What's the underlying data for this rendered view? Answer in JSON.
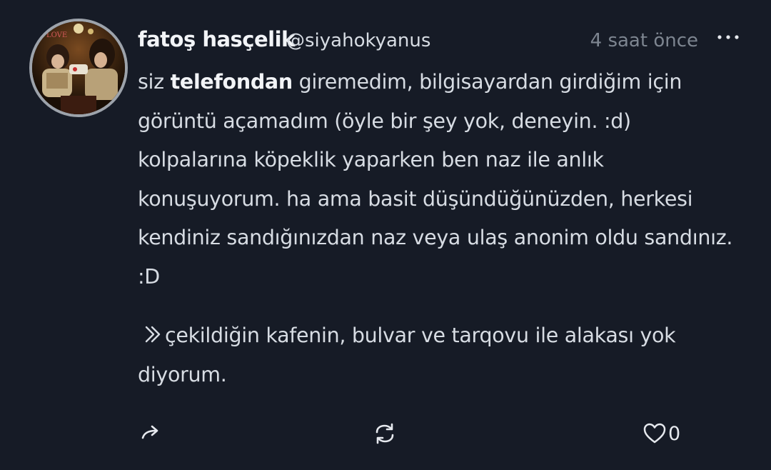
{
  "tweet": {
    "author": {
      "display_name": "fatoş hasçelik",
      "handle": "@siyahokyanus",
      "avatar_icon": "profile-photo",
      "avatar_text": "LOVE"
    },
    "timestamp": "4 saat önce",
    "more_icon": "ellipsis-icon",
    "body": {
      "p1_before": "siz ",
      "p1_bold": "telefondan",
      "p1_after": " giremedim, bilgisayardan girdiğim için görüntü açamadım (öyle bir şey yok, deneyin. :d) kolpalarına köpeklik yaparken ben naz ile anlık konuşuyorum. ha ama basit düşündüğünüzden, herkesi kendiniz sandığınızdan naz veya ulaş anonim oldu sandınız. :D",
      "quote_text": "çekildiğin kafenin, bulvar ve tarqovu ile alakası yok diyorum."
    },
    "actions": {
      "reply_icon": "reply-arrow-icon",
      "retweet_icon": "retweet-icon",
      "like_icon": "heart-icon",
      "like_count": "0"
    }
  },
  "colors": {
    "background": "#161b26",
    "text": "#d7dce3",
    "name": "#f2f4f7",
    "muted": "#7d8590",
    "avatar_border": "#9da3ab"
  }
}
